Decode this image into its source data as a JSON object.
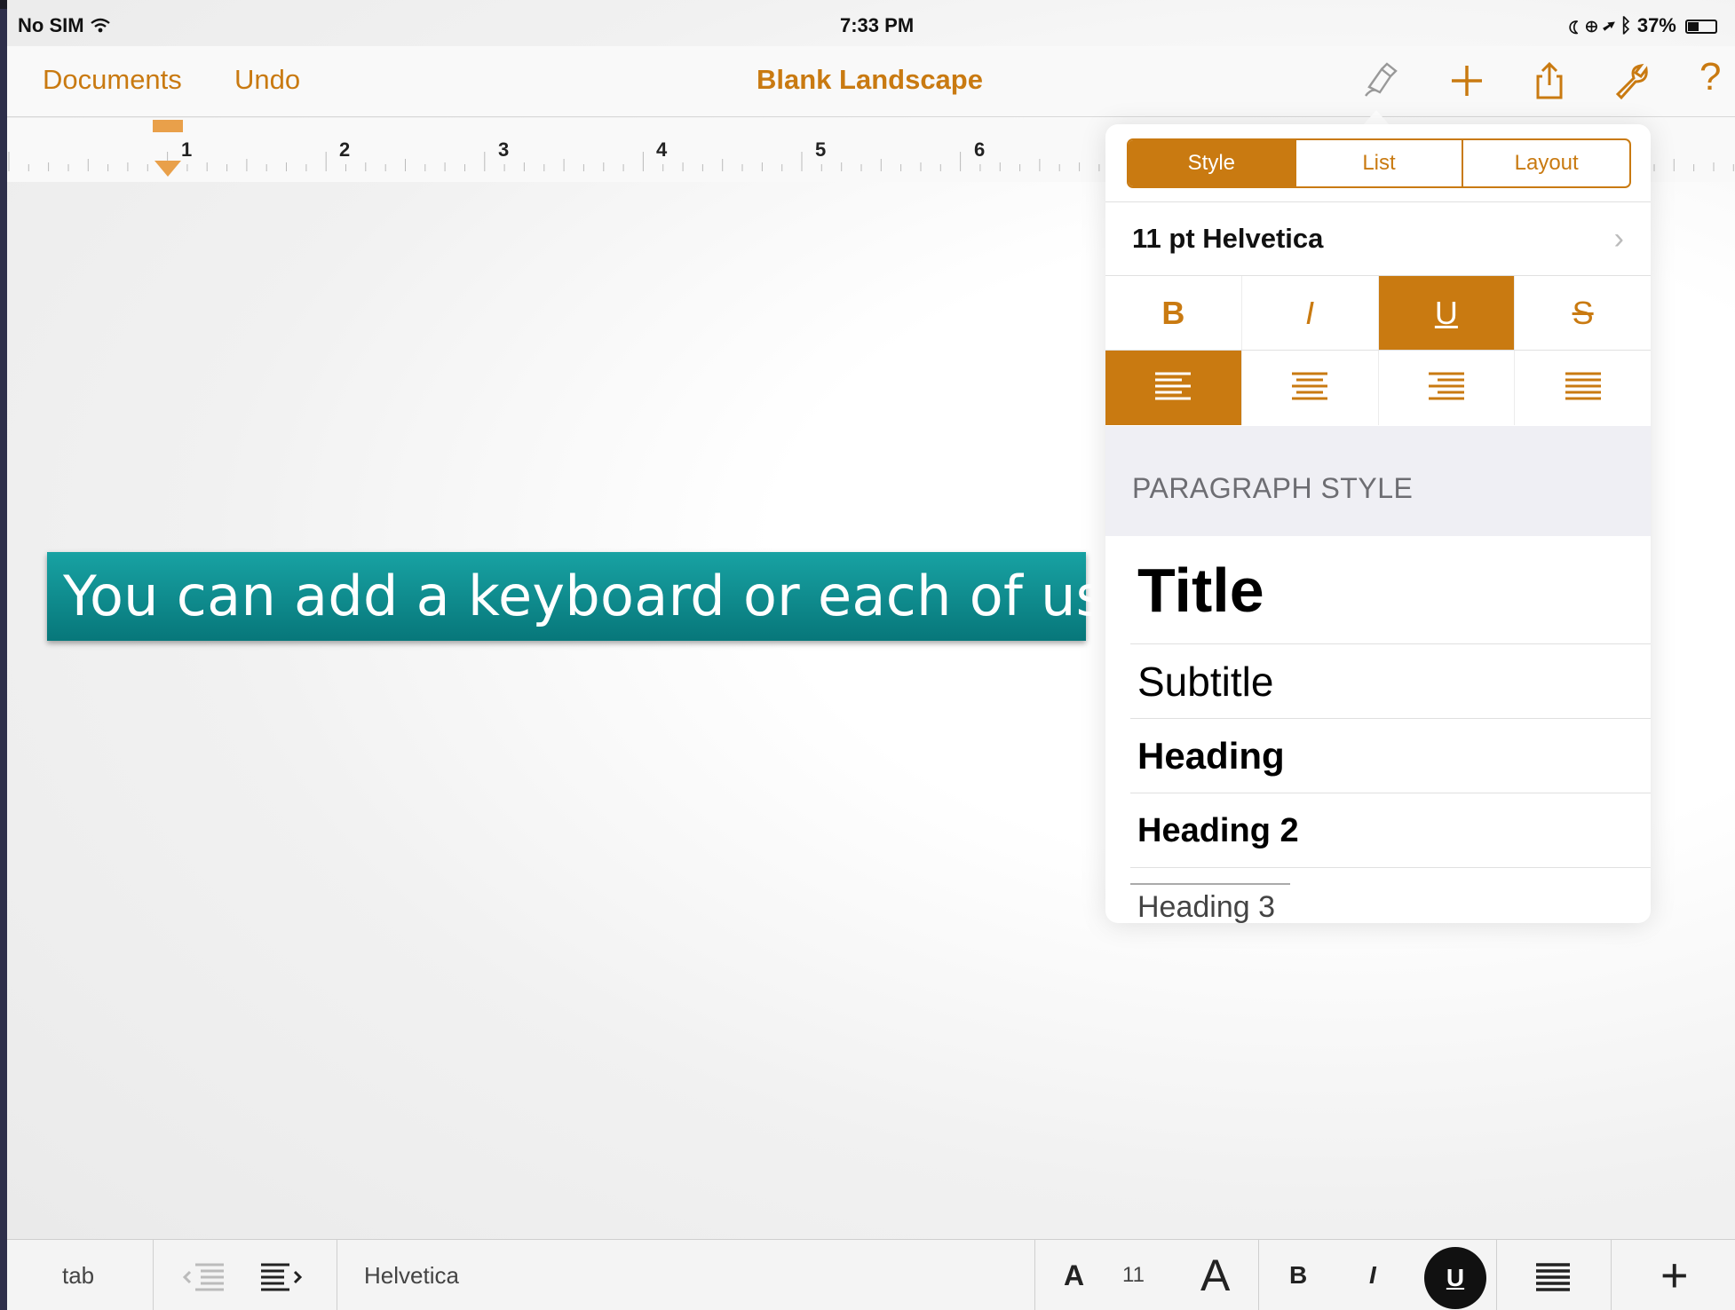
{
  "status_bar": {
    "carrier": "No SIM",
    "time": "7:33 PM",
    "battery": "37%"
  },
  "nav": {
    "documents": "Documents",
    "undo": "Undo",
    "title": "Blank Landscape",
    "icons": [
      "format-brush-icon",
      "plus-icon",
      "share-icon",
      "wrench-icon",
      "help-icon"
    ],
    "help_label": "?"
  },
  "ruler": {
    "numbers": [
      "1",
      "2",
      "3",
      "4",
      "5",
      "6"
    ]
  },
  "callout": {
    "text": "You can add a keyboard or each of use."
  },
  "popover": {
    "tabs": [
      {
        "label": "Style",
        "active": true
      },
      {
        "label": "List",
        "active": false
      },
      {
        "label": "Layout",
        "active": false
      }
    ],
    "font": "11 pt Helvetica",
    "styles": {
      "bold": "B",
      "italic": "I",
      "underline": "U",
      "strike": "S",
      "active": "underline"
    },
    "alignment_active": "left",
    "section_header": "PARAGRAPH STYLE",
    "paragraph_styles": [
      "Title",
      "Subtitle",
      "Heading",
      "Heading 2",
      "Heading 3"
    ]
  },
  "toolbar": {
    "tab": "tab",
    "font": "Helvetica",
    "size_small": "A",
    "size": "11",
    "size_large": "A",
    "bold": "B",
    "italic": "I",
    "underline": "U",
    "plus": "+"
  },
  "colors": {
    "accent": "#c97a11",
    "callout": "#0f8f91"
  }
}
